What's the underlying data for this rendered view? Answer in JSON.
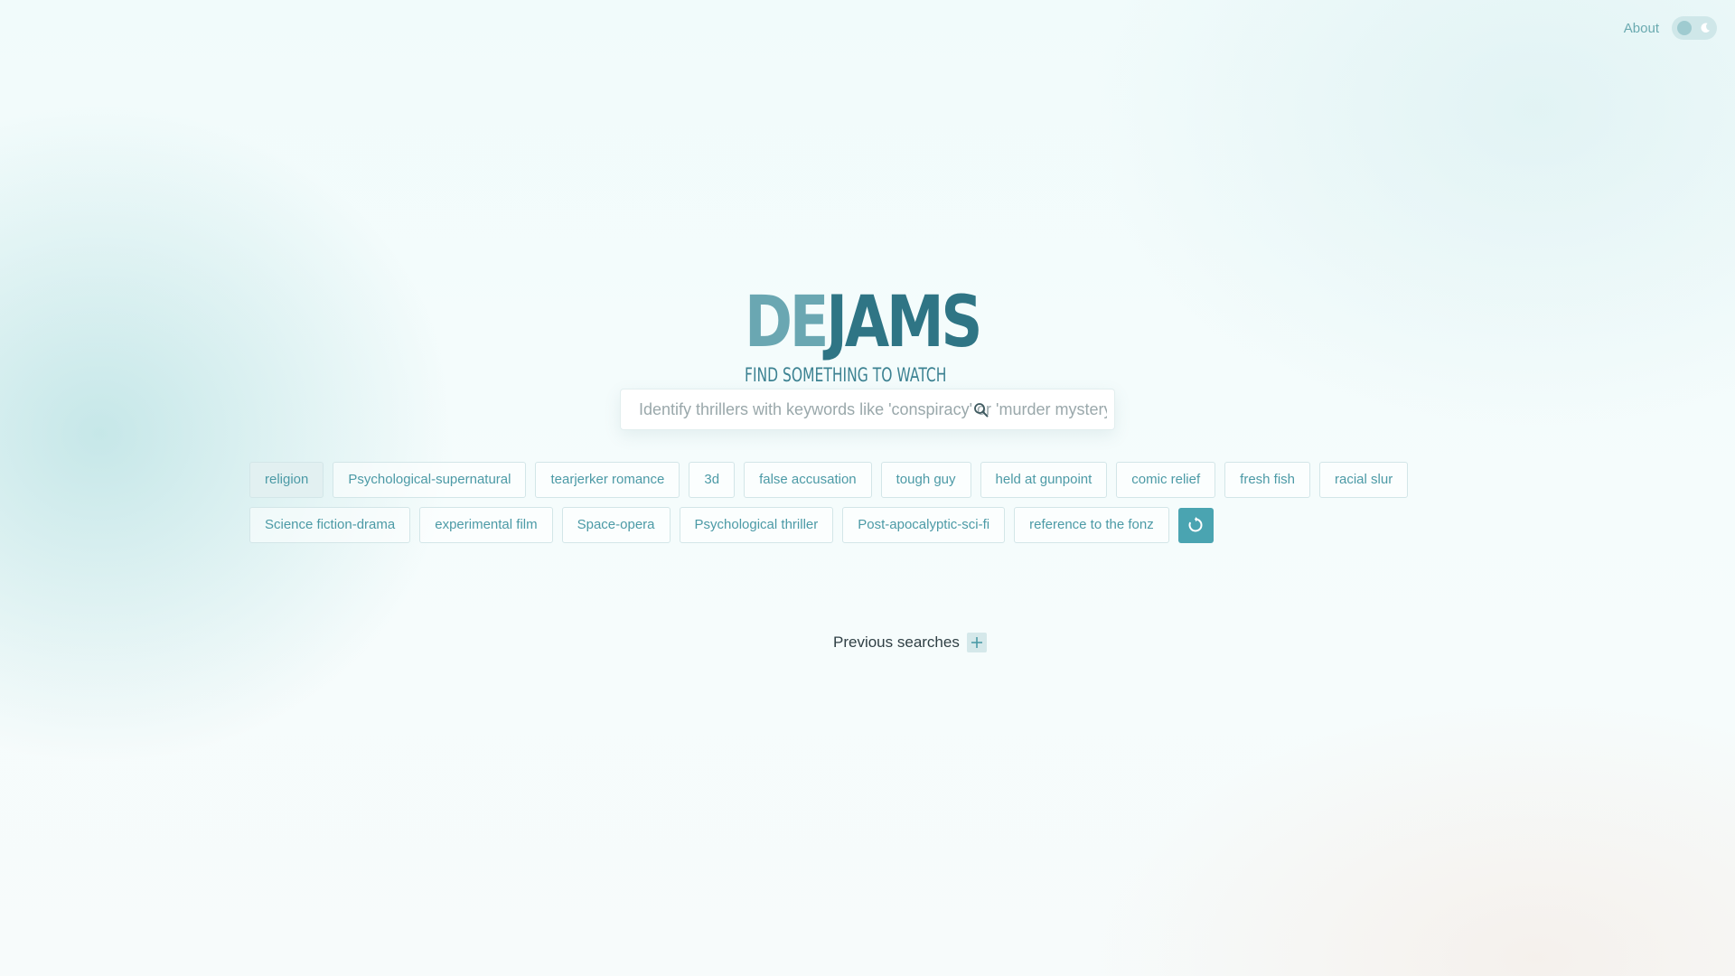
{
  "nav": {
    "about_label": "About",
    "theme_toggle_icon": "moon-icon"
  },
  "logo": {
    "word_part1": "DE",
    "word_part2": "JAMS",
    "tagline": "FIND SOMETHING TO WATCH",
    "colors": {
      "part1": "#6aa7b2",
      "part2": "#2f7585"
    }
  },
  "search": {
    "placeholder": "Identify thrillers with keywords like 'conspiracy' or 'murder mystery'",
    "value": "",
    "icon": "search-icon"
  },
  "tags": {
    "row1": [
      "religion",
      "Psychological-supernatural",
      "tearjerker romance",
      "3d",
      "false accusation",
      "tough guy",
      "held at gunpoint",
      "comic relief",
      "fresh fish",
      "racial slur"
    ],
    "row2": [
      "Science fiction-drama",
      "experimental film",
      "Space-opera",
      "Psychological thriller",
      "Post-apocalyptic-sci-fi",
      "reference to the fonz"
    ],
    "selected": "religion",
    "refresh_icon": "refresh-icon"
  },
  "previous_searches": {
    "label": "Previous searches",
    "expand_icon": "plus-icon"
  },
  "colors": {
    "accent": "#4aa4b1",
    "tag_text": "#4c9aa6",
    "tag_border": "#d3e6e8"
  }
}
